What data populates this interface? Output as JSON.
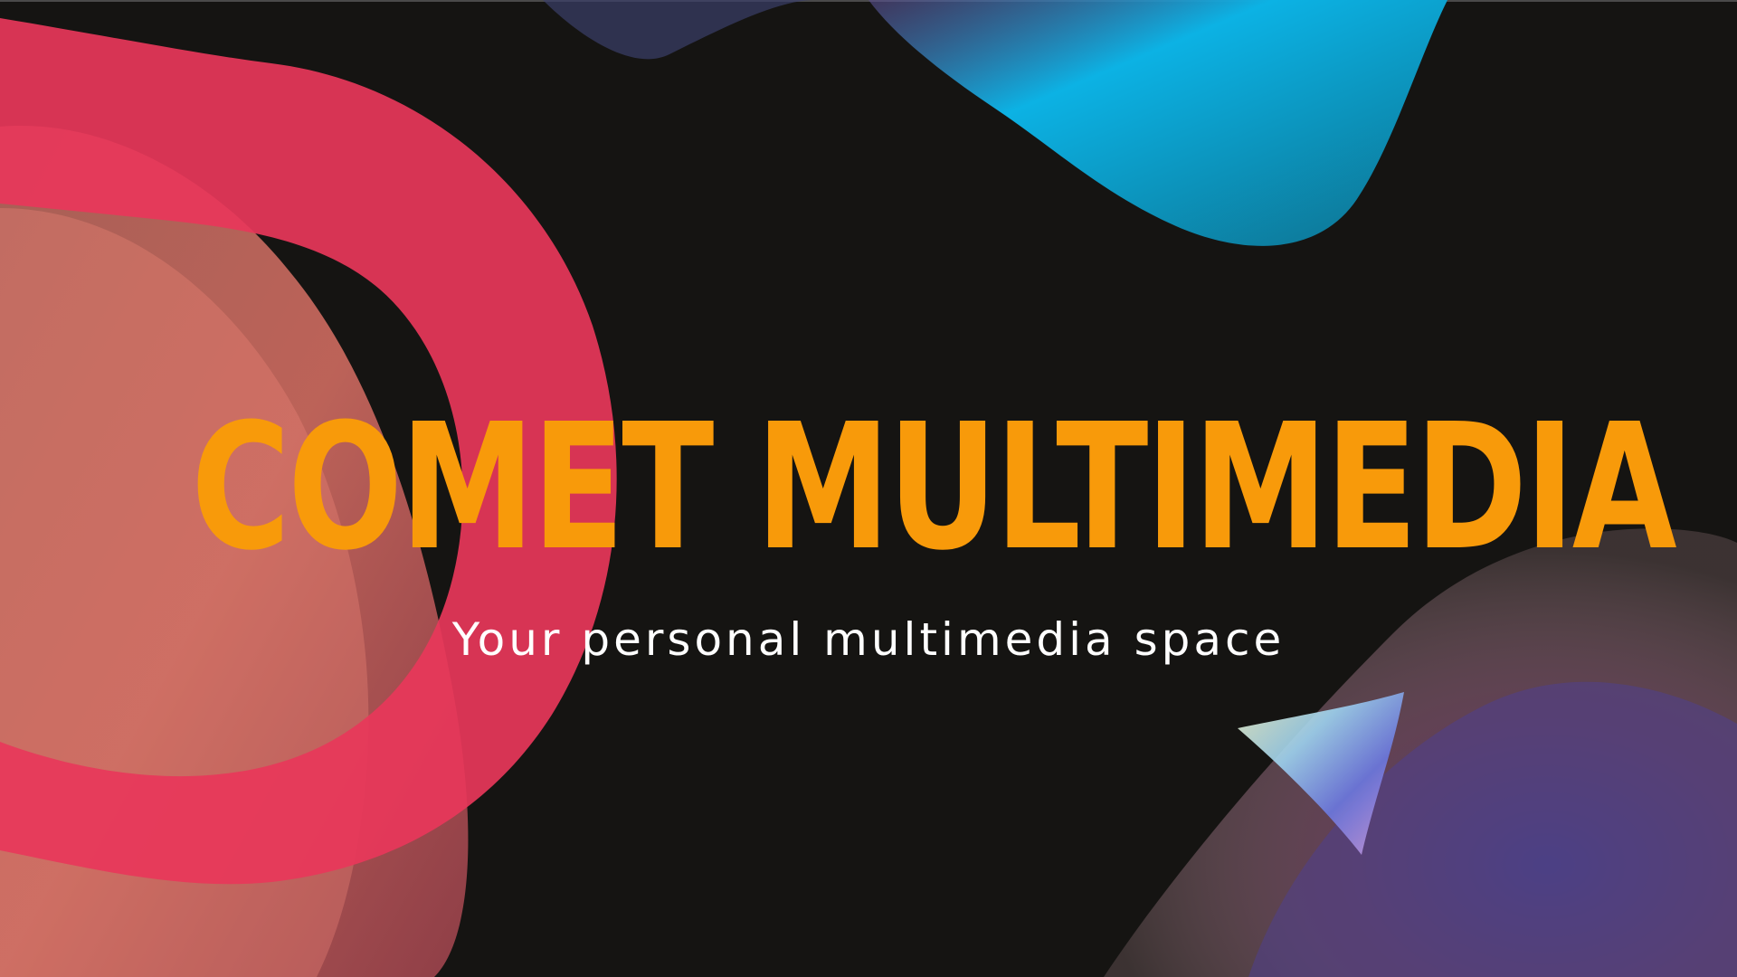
{
  "slide": {
    "title": "COMET MULTIMEDIA",
    "subtitle": "Your personal multimedia space"
  },
  "colors": {
    "background": "#151412",
    "title": "#f89a0a",
    "subtitle": "#ffffff",
    "ribbon": "#e8375a",
    "cyan_blob": "#0aa7d6"
  },
  "decor": {
    "shapes": [
      "pink-ribbon-shape",
      "peach-blob-shape",
      "cyan-blob-shape",
      "holographic-cone-shape",
      "iridescent-wave-shape"
    ]
  }
}
